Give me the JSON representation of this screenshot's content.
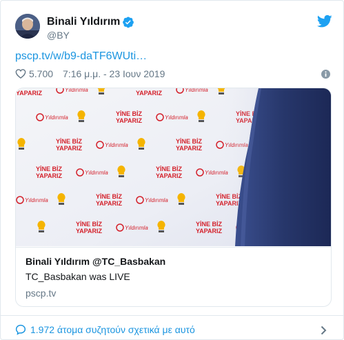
{
  "author": {
    "name": "Binali Yıldırım",
    "handle": "@BY"
  },
  "tweet": {
    "link_text": "pscp.tv/w/b9-daTF6WUti…",
    "likes": "5.700",
    "timestamp": "7:16 μ.μ. - 23 Ιουν 2019"
  },
  "card": {
    "title": "Binali Yıldırım @TC_Basbakan",
    "description": "TC_Basbakan was LIVE",
    "domain": "pscp.tv",
    "backdrop_texts": [
      "YİNE BİZ",
      "YAPARIZ",
      "Yıldırımla"
    ]
  },
  "footer": {
    "discussion": "1.972 άτομα συζητούν σχετικά με αυτό"
  },
  "colors": {
    "accent": "#1b95e0",
    "muted": "#657786",
    "text": "#14171a",
    "border": "#e1e8ed",
    "backdrop_red": "#d4202a",
    "backdrop_yellow": "#f5b400",
    "suit_navy": "#27376b"
  },
  "icons": {
    "verified": "verified-badge-icon",
    "brand": "twitter-bird-icon",
    "like": "heart-icon",
    "info": "info-icon",
    "comment": "speech-bubble-icon",
    "chevron": "chevron-right-icon"
  }
}
